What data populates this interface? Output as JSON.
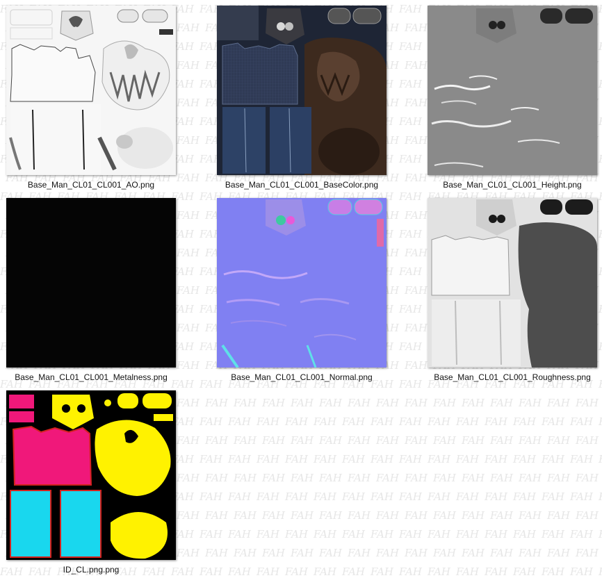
{
  "watermark_text": "FAH",
  "files": [
    {
      "name": "Base_Man_CL01_CL001_AO.png",
      "map": "ao"
    },
    {
      "name": "Base_Man_CL01_CL001_BaseColor.png",
      "map": "basecolor"
    },
    {
      "name": "Base_Man_CL01_CL001_Height.png",
      "map": "height"
    },
    {
      "name": "Base_Man_CL01_CL001_Metalness.png",
      "map": "metalness"
    },
    {
      "name": "Base_Man_CL01_CL001_Normal.png",
      "map": "normal"
    },
    {
      "name": "Base_Man_CL01_CL001_Roughness.png",
      "map": "roughness"
    },
    {
      "name": "ID_CL.png.png",
      "map": "id"
    }
  ],
  "colors": {
    "ao_bg": "#f4f4f4",
    "basecolor_shirt": "#2f3a55",
    "basecolor_pants": "#2d4266",
    "basecolor_brown": "#3d2a1e",
    "height_bg": "#8a8a8a",
    "metalness_bg": "#050505",
    "normal_bg": "#8080f2",
    "roughness_light": "#f0f0f0",
    "roughness_dark": "#4d4d4d",
    "id_bg": "#000000",
    "id_magenta": "#f0187a",
    "id_yellow": "#fff200",
    "id_cyan": "#19d7ee",
    "id_red": "#d2221e"
  }
}
